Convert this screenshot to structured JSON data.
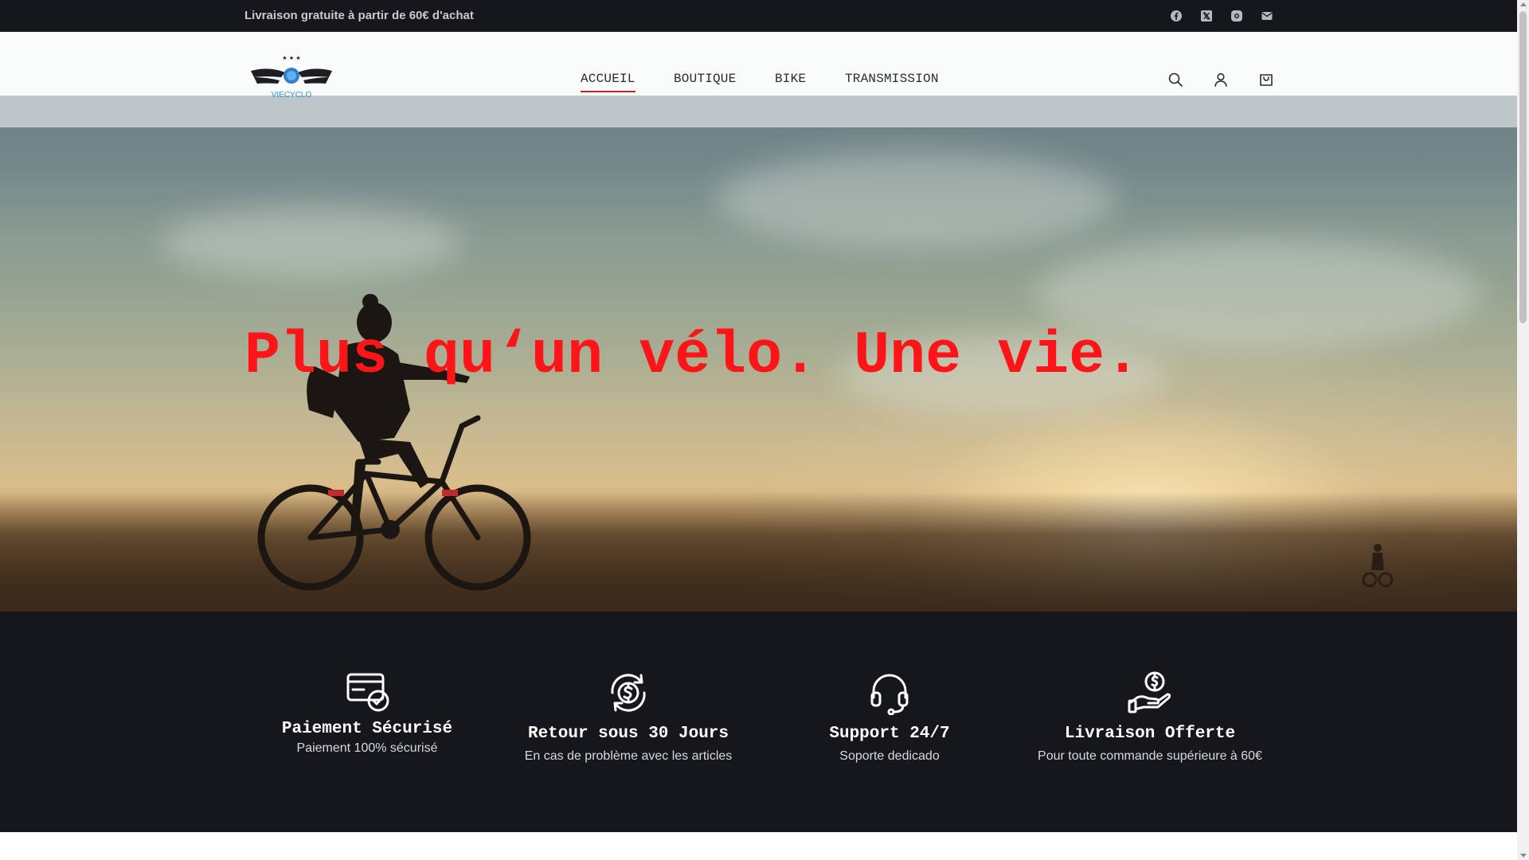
{
  "topbar": {
    "announcement": "Livraison gratuite à partir de 60€ d'achat",
    "social_icons": [
      "facebook-icon",
      "x-twitter-icon",
      "instagram-icon",
      "mail-icon"
    ]
  },
  "header": {
    "logo_text": "VIECYCLO",
    "nav": [
      {
        "label": "ACCUEIL",
        "active": true
      },
      {
        "label": "BOUTIQUE",
        "active": false
      },
      {
        "label": "BIKE",
        "active": false
      },
      {
        "label": "TRANSMISSION",
        "active": false
      }
    ],
    "icons": [
      "search-icon",
      "account-icon",
      "cart-icon"
    ]
  },
  "hero": {
    "title": "Plus qu‘un vélo. Une vie."
  },
  "features": [
    {
      "icon": "secure-card-icon",
      "title": "Paiement Sécurisé",
      "text": "Paiement 100% sécurisé"
    },
    {
      "icon": "refund-cycle-icon",
      "title": "Retour sous 30 Jours",
      "text": "En cas de problème avec les articles"
    },
    {
      "icon": "headset-icon",
      "title": "Support 24/7",
      "text": "Soporte dedicado"
    },
    {
      "icon": "hand-coin-icon",
      "title": "Livraison Offerte",
      "text": "Pour toute commande supérieure à 60€"
    }
  ],
  "colors": {
    "accent": "#ff1418",
    "nav_underline": "#d61f26",
    "dark_bg": "#16171c",
    "logo_blue": "#3a8fd6"
  }
}
